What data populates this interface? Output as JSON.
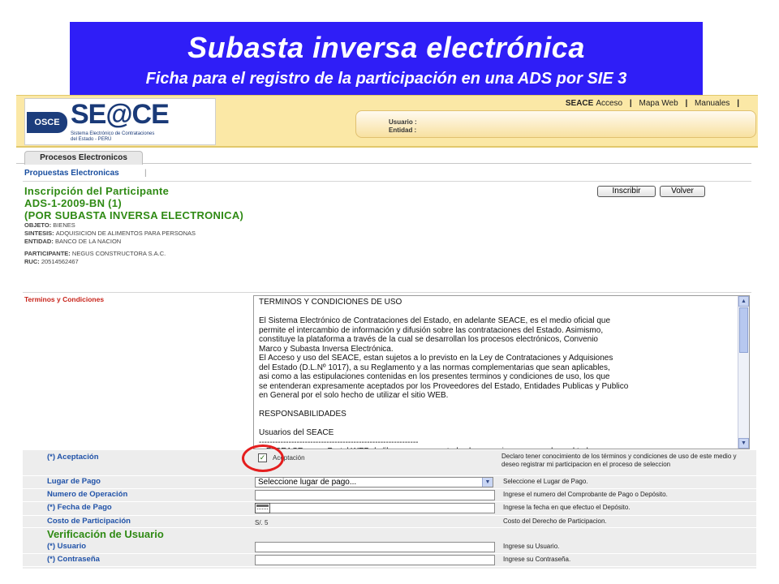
{
  "banner": {
    "title": "Subasta inversa electrónica",
    "subtitle": "Ficha para el registro de la participación en una ADS por SIE    3"
  },
  "header": {
    "logo_badge": "OSCE",
    "logo_brand": "SE@CE",
    "logo_line1": "Sistema Electrónico de Contrataciones",
    "logo_line2": "del Estado - PERÚ",
    "links": {
      "seace": "SEACE",
      "acceso": "Acceso",
      "sep": "|",
      "mapa_web": "Mapa Web",
      "manuales": "Manuales"
    },
    "usuario_label": "Usuario :",
    "entidad_label": "Entidad :"
  },
  "tabs": {
    "active": "Procesos Electronicos"
  },
  "subnav": {
    "item": "Propuestas Electronicas",
    "sep": "|"
  },
  "process": {
    "title": "Inscripción del Participante",
    "code": "ADS-1-2009-BN (1)",
    "type": "(POR SUBASTA INVERSA ELECTRONICA)",
    "objeto_label": "OBJETO:",
    "objeto": "BIENES",
    "sintesis_label": "SINTESIS:",
    "sintesis": "ADQUISICION DE ALIMENTOS PARA PERSONAS",
    "entidad_label": "ENTIDAD:",
    "entidad": "BANCO DE LA NACION",
    "participante_label": "PARTICIPANTE:",
    "participante": "NEGUS CONSTRUCTORA S.A.C.",
    "ruc_label": "RUC:",
    "ruc": "20514562467"
  },
  "buttons": {
    "inscribir": "Inscribir",
    "volver": "Volver"
  },
  "terms": {
    "label": "Terminos y Condiciones",
    "text": "TERMINOS Y CONDICIONES DE USO\n\nEl Sistema Electrónico de Contrataciones del Estado, en adelante SEACE, es el medio oficial que\npermite el intercambio de información y difusión sobre las contrataciones del Estado. Asimismo,\nconstituye la plataforma a través de la cual se desarrollan los procesos electrónicos, Convenio\nMarco y Subasta Inversa Electrónica.\nEl Acceso y uso del SEACE, estan sujetos a lo previsto en la Ley de Contrataciones y Adquisiones\ndel Estado (D.L.Nº 1017), a su Reglamento y a las normas complementarias que sean aplicables,\nasi como a las estipulaciones contenidas en los presentes terminos y condiciones de uso, los que\nse entenderan expresamente aceptados por los Proveedores del Estado, Entidades Publicas y Publico\nen General por el solo hecho de utilizar el sitio WEB.\n\nRESPONSABILIDADES\n\nUsuarios del SEACE\n-----------------------------------------------------------\n-  El SEACE es un Portal WEB de libre acceso para todos los usuarios razon por la cual toda\n   información y su contenido asi como la veracidad, integridad y totalidad de la misma es de"
  },
  "form": {
    "aceptacion": {
      "label": "(*) Aceptación",
      "checkbox_label": "Aceptación",
      "checked": true,
      "help": "Declaro tener conocimiento de los términos y condiciones de uso de este medio y deseo registrar mi participacion en el proceso de seleccion"
    },
    "lugar_pago": {
      "label": "Lugar de Pago",
      "value": "Seleccione lugar de pago...",
      "help": "Seleccione el Lugar de Pago."
    },
    "numero_operacion": {
      "label": "Numero de Operación",
      "value": "",
      "help": "Ingrese el numero del Comprobante de Pago o Depósito."
    },
    "fecha_pago": {
      "label": "(*) Fecha de Pago",
      "value": "",
      "help": "Ingrese la fecha en que efectuo el Depósito."
    },
    "costo": {
      "label": "Costo de Participación",
      "value": "S/. 5",
      "help": "Costo del Derecho de Participacion."
    },
    "verificacion_title": "Verificación de Usuario",
    "usuario": {
      "label": "(*) Usuario",
      "value": "",
      "help": "Ingrese su Usuario."
    },
    "contrasena": {
      "label": "(*) Contraseña",
      "value": "",
      "help": "Ingrese su Contraseña."
    }
  },
  "colors": {
    "banner_bg": "#2f1ef7",
    "header_bg": "#fbe8a6",
    "green_heading": "#2f8a14",
    "label_blue": "#2052a8",
    "terms_red": "#c8241b",
    "highlight_circle": "#e41d1d"
  }
}
